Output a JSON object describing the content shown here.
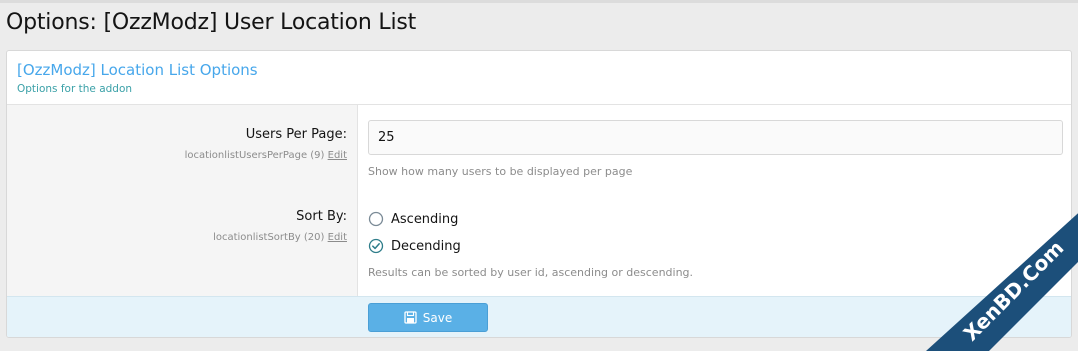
{
  "page": {
    "title": "Options: [OzzModz] User Location List"
  },
  "block": {
    "title": "[OzzModz] Location List Options",
    "description": "Options for the addon"
  },
  "options": [
    {
      "label": "Users Per Page:",
      "key": "locationlistUsersPerPage (9)",
      "edit_label": "Edit",
      "value": "25",
      "hint": "Show how many users to be displayed per page"
    },
    {
      "label": "Sort By:",
      "key": "locationlistSortBy (20)",
      "edit_label": "Edit",
      "choices": [
        {
          "label": "Ascending",
          "selected": false
        },
        {
          "label": "Decending",
          "selected": true
        }
      ],
      "hint": "Results can be sorted by user id, ascending or descending."
    }
  ],
  "footer": {
    "save_label": "Save",
    "save_icon": "save-icon"
  },
  "watermark": {
    "text": "XenBD.Com"
  },
  "colors": {
    "accent": "#47a7eb",
    "button": "#5ab0e6",
    "footer_bg": "#e5f3fa",
    "watermark": "#1c4f7a"
  }
}
